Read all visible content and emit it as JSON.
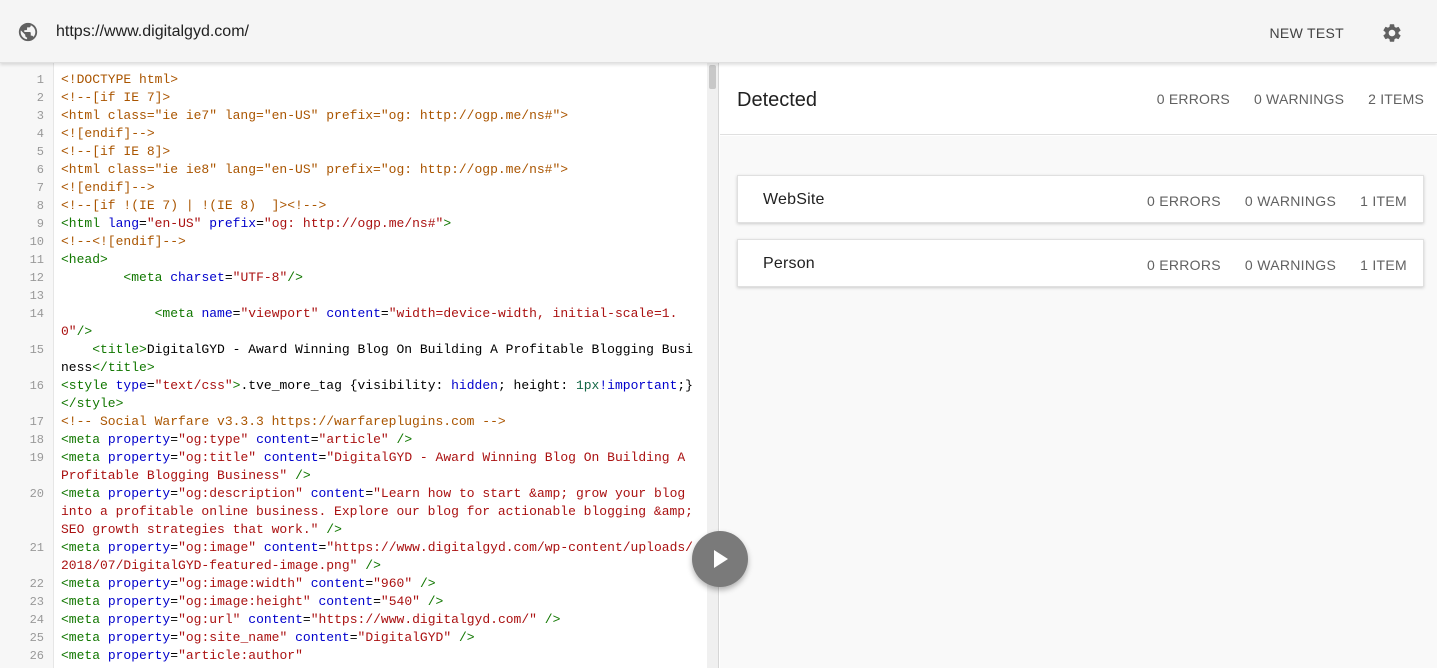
{
  "topbar": {
    "url": "https://www.digitalgyd.com/",
    "new_test_label": "NEW TEST",
    "globe_icon": "globe-icon",
    "settings_icon": "gear-icon"
  },
  "editor": {
    "lines": [
      {
        "n": "1",
        "html": "<span class=\"c-com\">&lt;!DOCTYPE html&gt;</span>"
      },
      {
        "n": "2",
        "html": "<span class=\"c-com\">&lt;!--[if IE 7]&gt;</span>"
      },
      {
        "n": "3",
        "html": "<span class=\"c-com\">&lt;html class=\"ie ie7\" lang=\"en-US\" prefix=\"og: http://ogp.me/ns#\"&gt;</span>"
      },
      {
        "n": "4",
        "html": "<span class=\"c-com\">&lt;![endif]--&gt;</span>"
      },
      {
        "n": "5",
        "html": "<span class=\"c-com\">&lt;!--[if IE 8]&gt;</span>"
      },
      {
        "n": "6",
        "html": "<span class=\"c-com\">&lt;html class=\"ie ie8\" lang=\"en-US\" prefix=\"og: http://ogp.me/ns#\"&gt;</span>"
      },
      {
        "n": "7",
        "html": "<span class=\"c-com\">&lt;![endif]--&gt;</span>"
      },
      {
        "n": "8",
        "html": "<span class=\"c-com\">&lt;!--[if !(IE 7) | !(IE 8)  ]&gt;&lt;!--&gt;</span>"
      },
      {
        "n": "9",
        "html": "<span class=\"c-tag\">&lt;html</span> <span class=\"c-attr\">lang</span>=<span class=\"c-str\">\"en-US\"</span> <span class=\"c-attr\">prefix</span>=<span class=\"c-str\">\"og: http://ogp.me/ns#\"</span><span class=\"c-tag\">&gt;</span>"
      },
      {
        "n": "10",
        "html": "<span class=\"c-com\">&lt;!--&lt;![endif]--&gt;</span>"
      },
      {
        "n": "11",
        "html": "<span class=\"c-tag\">&lt;head&gt;</span>"
      },
      {
        "n": "12",
        "html": "        <span class=\"c-tag\">&lt;meta</span> <span class=\"c-attr\">charset</span>=<span class=\"c-str\">\"UTF-8\"</span><span class=\"c-tag\">/&gt;</span>"
      },
      {
        "n": "13",
        "html": " "
      },
      {
        "n": "14",
        "html": "            <span class=\"c-tag\">&lt;meta</span> <span class=\"c-attr\">name</span>=<span class=\"c-str\">\"viewport\"</span> <span class=\"c-attr\">content</span>=<span class=\"c-str\">\"width=device-width, initial-scale=1.0\"</span><span class=\"c-tag\">/&gt;</span>"
      },
      {
        "n": "15",
        "html": "    <span class=\"c-tag\">&lt;title&gt;</span>DigitalGYD - Award Winning Blog On Building A Profitable Blogging Business<span class=\"c-tag\">&lt;/title&gt;</span>"
      },
      {
        "n": "16",
        "html": "<span class=\"c-tag\">&lt;style</span> <span class=\"c-attr\">type</span>=<span class=\"c-str\">\"text/css\"</span><span class=\"c-tag\">&gt;</span>.tve_more_tag {visibility: <span class=\"c-attr\">hidden</span>; height: <span class=\"c-num\">1px</span><span class=\"c-attr\">!important</span>;}<span class=\"c-tag\">&lt;/style&gt;</span>"
      },
      {
        "n": "17",
        "html": "<span class=\"c-com\">&lt;!-- Social Warfare v3.3.3 https://warfareplugins.com --&gt;</span>"
      },
      {
        "n": "18",
        "html": "<span class=\"c-tag\">&lt;meta</span> <span class=\"c-attr\">property</span>=<span class=\"c-str\">\"og:type\"</span> <span class=\"c-attr\">content</span>=<span class=\"c-str\">\"article\"</span> <span class=\"c-tag\">/&gt;</span>"
      },
      {
        "n": "19",
        "html": "<span class=\"c-tag\">&lt;meta</span> <span class=\"c-attr\">property</span>=<span class=\"c-str\">\"og:title\"</span> <span class=\"c-attr\">content</span>=<span class=\"c-str\">\"DigitalGYD - Award Winning Blog On Building A Profitable Blogging Business\"</span> <span class=\"c-tag\">/&gt;</span>"
      },
      {
        "n": "20",
        "html": "<span class=\"c-tag\">&lt;meta</span> <span class=\"c-attr\">property</span>=<span class=\"c-str\">\"og:description\"</span> <span class=\"c-attr\">content</span>=<span class=\"c-str\">\"Learn how to start &amp;amp; grow your blog into a profitable online business. Explore our blog for actionable blogging &amp;amp; SEO growth strategies that work.\"</span> <span class=\"c-tag\">/&gt;</span>"
      },
      {
        "n": "21",
        "html": "<span class=\"c-tag\">&lt;meta</span> <span class=\"c-attr\">property</span>=<span class=\"c-str\">\"og:image\"</span> <span class=\"c-attr\">content</span>=<span class=\"c-str\">\"https://www.digitalgyd.com/wp-content/uploads/2018/07/DigitalGYD-featured-image.png\"</span> <span class=\"c-tag\">/&gt;</span>"
      },
      {
        "n": "22",
        "html": "<span class=\"c-tag\">&lt;meta</span> <span class=\"c-attr\">property</span>=<span class=\"c-str\">\"og:image:width\"</span> <span class=\"c-attr\">content</span>=<span class=\"c-str\">\"960\"</span> <span class=\"c-tag\">/&gt;</span>"
      },
      {
        "n": "23",
        "html": "<span class=\"c-tag\">&lt;meta</span> <span class=\"c-attr\">property</span>=<span class=\"c-str\">\"og:image:height\"</span> <span class=\"c-attr\">content</span>=<span class=\"c-str\">\"540\"</span> <span class=\"c-tag\">/&gt;</span>"
      },
      {
        "n": "24",
        "html": "<span class=\"c-tag\">&lt;meta</span> <span class=\"c-attr\">property</span>=<span class=\"c-str\">\"og:url\"</span> <span class=\"c-attr\">content</span>=<span class=\"c-str\">\"https://www.digitalgyd.com/\"</span> <span class=\"c-tag\">/&gt;</span>"
      },
      {
        "n": "25",
        "html": "<span class=\"c-tag\">&lt;meta</span> <span class=\"c-attr\">property</span>=<span class=\"c-str\">\"og:site_name\"</span> <span class=\"c-attr\">content</span>=<span class=\"c-str\">\"DigitalGYD\"</span> <span class=\"c-tag\">/&gt;</span>"
      },
      {
        "n": "26",
        "html": "<span class=\"c-tag\">&lt;meta</span> <span class=\"c-attr\">property</span>=<span class=\"c-str\">\"article:author\"</span>"
      }
    ]
  },
  "results": {
    "title": "Detected",
    "errors": "0 ERRORS",
    "warnings": "0 WARNINGS",
    "items": "2 ITEMS",
    "cards": [
      {
        "name": "WebSite",
        "errors": "0 ERRORS",
        "warnings": "0 WARNINGS",
        "items": "1 ITEM"
      },
      {
        "name": "Person",
        "errors": "0 ERRORS",
        "warnings": "0 WARNINGS",
        "items": "1 ITEM"
      }
    ]
  },
  "run_button_icon": "play-icon",
  "colors": {
    "topbar_bg": "#f5f5f5",
    "play_button": "#7a7a7a",
    "tag": "#117700",
    "attr": "#0000cc",
    "string": "#aa1111",
    "comment": "#aa5500"
  }
}
